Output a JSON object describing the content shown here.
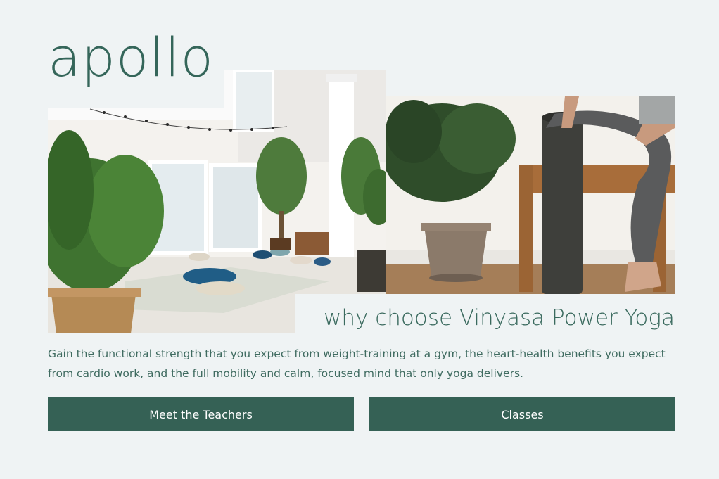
{
  "brand": {
    "logo_text": "apollo"
  },
  "hero": {
    "headline": "why choose Vinyasa Power Yoga",
    "description": "Gain the functional strength that you expect from weight-training at a gym, the heart-health benefits you expect from cardio work, and the full mobility and calm, focused mind that only yoga delivers."
  },
  "actions": {
    "teachers_label": "Meet the Teachers",
    "classes_label": "Classes"
  },
  "colors": {
    "background": "#eff3f4",
    "accent": "#356155",
    "text": "#3f6b60"
  }
}
